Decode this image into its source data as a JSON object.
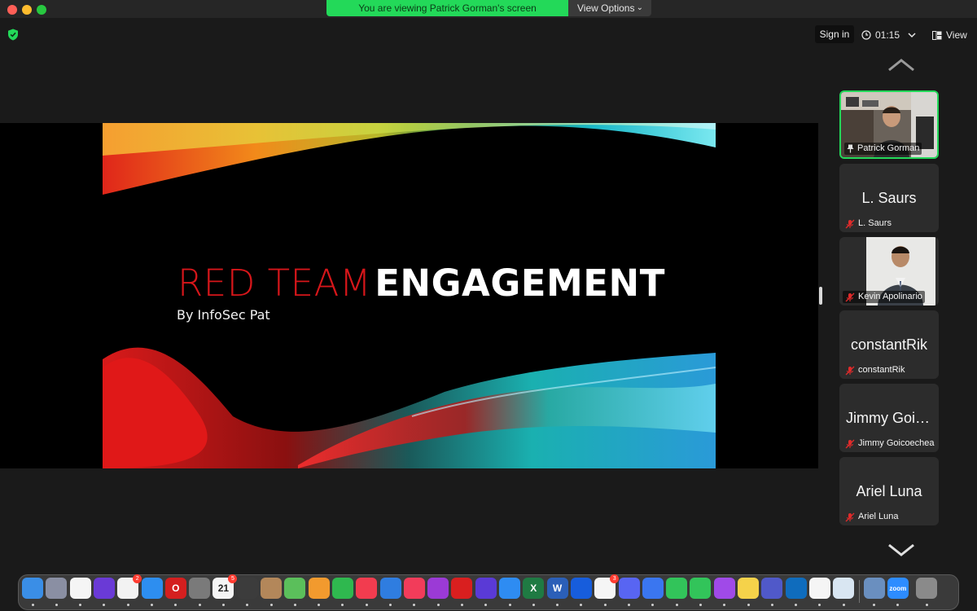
{
  "window": {
    "titlebar_present": true
  },
  "share_banner": {
    "text": "You are viewing Patrick Gorman's screen",
    "view_options_label": "View Options"
  },
  "toolbar": {
    "sign_in_label": "Sign in",
    "timer": "01:15",
    "view_label": "View"
  },
  "slide": {
    "title_red": "RED TEAM",
    "title_white": "ENGAGEMENT",
    "subtitle": "By InfoSec Pat"
  },
  "participants": [
    {
      "name": "Patrick Gorman",
      "tile_text": "",
      "video": true,
      "pinned": true,
      "muted": false,
      "active_speaker": true
    },
    {
      "name": "L. Saurs",
      "tile_text": "L. Saurs",
      "video": false,
      "pinned": false,
      "muted": true
    },
    {
      "name": "Kevin Apolinario",
      "tile_text": "",
      "video": true,
      "pinned": false,
      "muted": true
    },
    {
      "name": "constantRik",
      "tile_text": "constantRik",
      "video": false,
      "pinned": false,
      "muted": true
    },
    {
      "name": "Jimmy Goicoechea",
      "tile_text": "Jimmy Goico...",
      "video": false,
      "pinned": false,
      "muted": true
    },
    {
      "name": "Ariel Luna",
      "tile_text": "Ariel Luna",
      "video": false,
      "pinned": false,
      "muted": true
    }
  ],
  "dock": {
    "apps": [
      {
        "name": "finder-icon",
        "color": "#3a8ee6",
        "glyph": ""
      },
      {
        "name": "launchpad-icon",
        "color": "#8a8fa3",
        "glyph": ""
      },
      {
        "name": "photos-icon",
        "color": "#f5f5f5",
        "glyph": ""
      },
      {
        "name": "siri-icon",
        "color": "#6a3ad6",
        "glyph": ""
      },
      {
        "name": "reminders-icon",
        "color": "#f2f2f2",
        "glyph": "",
        "badge": "2"
      },
      {
        "name": "safari-icon",
        "color": "#2d8ef0",
        "glyph": ""
      },
      {
        "name": "opera-icon",
        "color": "#d41f1f",
        "glyph": "O"
      },
      {
        "name": "system-preferences-icon",
        "color": "#7a7a7a",
        "glyph": ""
      },
      {
        "name": "calendar-icon",
        "color": "#f5f5f5",
        "glyph": "21",
        "badge": "5"
      },
      {
        "name": "calculator-icon",
        "color": "#3c3c3c",
        "glyph": ""
      },
      {
        "name": "contacts-icon",
        "color": "#b3875a",
        "glyph": ""
      },
      {
        "name": "maps-icon",
        "color": "#5bbf5b",
        "glyph": ""
      },
      {
        "name": "pages-icon",
        "color": "#f29a2e",
        "glyph": ""
      },
      {
        "name": "numbers-icon",
        "color": "#2fb84f",
        "glyph": ""
      },
      {
        "name": "news-icon",
        "color": "#f23c4f",
        "glyph": ""
      },
      {
        "name": "keynote-icon",
        "color": "#2f7de0",
        "glyph": ""
      },
      {
        "name": "music-icon",
        "color": "#f23c5a",
        "glyph": ""
      },
      {
        "name": "podcasts-icon",
        "color": "#9b3ad6",
        "glyph": ""
      },
      {
        "name": "acrobat-icon",
        "color": "#d91f1f",
        "glyph": ""
      },
      {
        "name": "imovie-icon",
        "color": "#5a3ad6",
        "glyph": ""
      },
      {
        "name": "app-store-icon",
        "color": "#2e8cf2",
        "glyph": ""
      },
      {
        "name": "excel-icon",
        "color": "#1f7a43",
        "glyph": "X"
      },
      {
        "name": "word-icon",
        "color": "#2b5fb8",
        "glyph": "W"
      },
      {
        "name": "bitwarden-icon",
        "color": "#175ddc",
        "glyph": ""
      },
      {
        "name": "slack-icon",
        "color": "#f5f5f5",
        "glyph": "",
        "badge": "3"
      },
      {
        "name": "discord-icon",
        "color": "#5865f2",
        "glyph": ""
      },
      {
        "name": "signal-icon",
        "color": "#3a76f0",
        "glyph": ""
      },
      {
        "name": "messages-icon",
        "color": "#32c45a",
        "glyph": ""
      },
      {
        "name": "facetime-icon",
        "color": "#32c45a",
        "glyph": ""
      },
      {
        "name": "messenger-icon",
        "color": "#a04ae8",
        "glyph": ""
      },
      {
        "name": "notes-icon",
        "color": "#f5d24a",
        "glyph": ""
      },
      {
        "name": "teams-icon",
        "color": "#5059c9",
        "glyph": ""
      },
      {
        "name": "outlook-icon",
        "color": "#0f6cbd",
        "glyph": ""
      },
      {
        "name": "chrome-icon",
        "color": "#f5f5f5",
        "glyph": ""
      },
      {
        "name": "preview-icon",
        "color": "#d9e6f2",
        "glyph": ""
      },
      {
        "name": "screen-share-icon",
        "color": "#6a8fbf",
        "glyph": ""
      },
      {
        "name": "zoom-icon",
        "color": "#2d8cff",
        "glyph": "zoom"
      },
      {
        "name": "trash-icon",
        "color": "#8a8a8a",
        "glyph": ""
      }
    ]
  }
}
